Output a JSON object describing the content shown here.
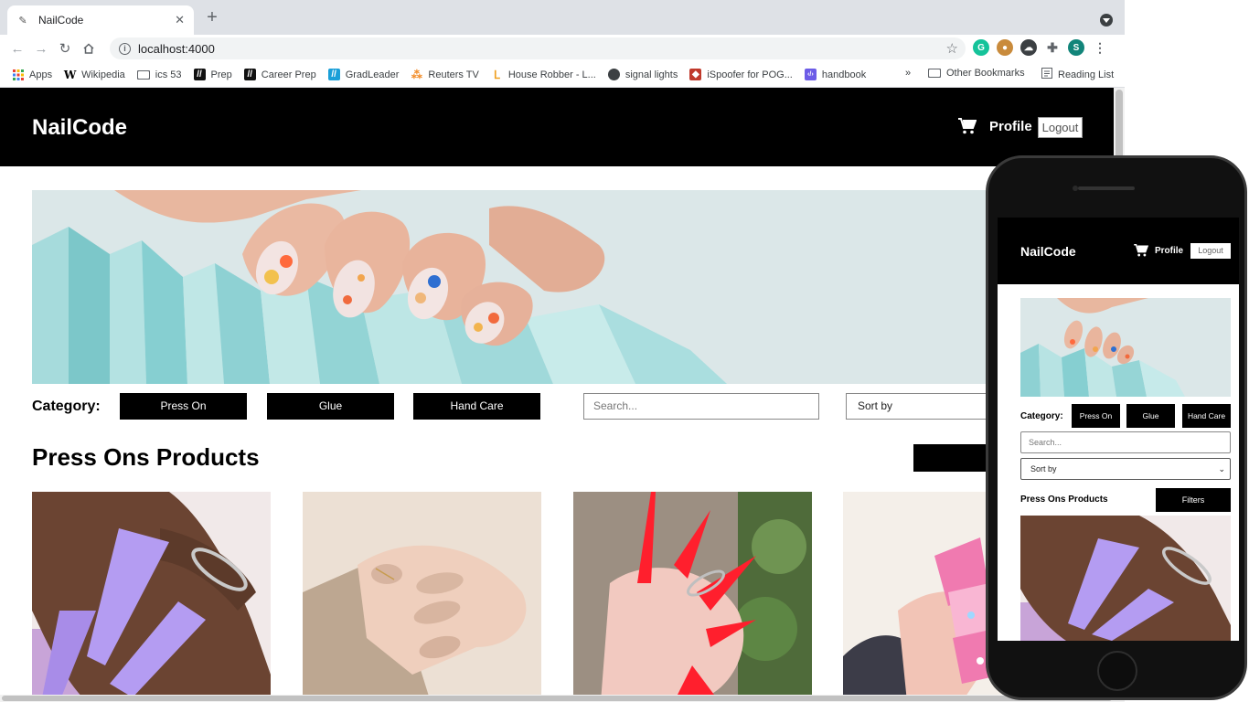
{
  "browser": {
    "tab_title": "NailCode",
    "url": "localhost:4000",
    "bookmarks": [
      {
        "label": "Apps",
        "icon": "apps-grid-icon",
        "color": "#ea4335"
      },
      {
        "label": "Wikipedia",
        "icon": "wikipedia-icon",
        "color": "#000000"
      },
      {
        "label": "ics 53",
        "icon": "folder-icon",
        "color": "#5f6368"
      },
      {
        "label": "Prep",
        "icon": "prep-icon",
        "color": "#111111"
      },
      {
        "label": "Career Prep",
        "icon": "career-prep-icon",
        "color": "#111111"
      },
      {
        "label": "GradLeader",
        "icon": "gradleader-icon",
        "color": "#1a9fd8"
      },
      {
        "label": "Reuters TV",
        "icon": "reuters-icon",
        "color": "#f28c28"
      },
      {
        "label": "House Robber - L...",
        "icon": "leetcode-icon",
        "color": "#f0a020"
      },
      {
        "label": "signal lights",
        "icon": "globe-icon",
        "color": "#3c4043"
      },
      {
        "label": "iSpoofer for POG...",
        "icon": "ispoofer-icon",
        "color": "#c0392b"
      },
      {
        "label": "handbook",
        "icon": "code-icon",
        "color": "#6c5ce7"
      }
    ],
    "overflow": "»",
    "other_bookmarks": "Other Bookmarks",
    "reading_list": "Reading List",
    "avatar_letter": "S"
  },
  "site": {
    "brand": "NailCode",
    "profile": "Profile",
    "logout": "Logout",
    "category_label": "Category:",
    "categories": [
      "Press On",
      "Glue",
      "Hand Care"
    ],
    "search_placeholder": "Search...",
    "sort_label": "Sort by",
    "products_title": "Press Ons Products",
    "filters_label": "Filters"
  },
  "mobile": {
    "brand": "NailCode",
    "profile": "Profile",
    "logout": "Logout",
    "category_label": "Category:",
    "categories": [
      "Press On",
      "Glue",
      "Hand Care"
    ],
    "search_placeholder": "Search...",
    "sort_label": "Sort by",
    "products_title": "Press Ons Products",
    "filters_label": "Filters"
  },
  "colors": {
    "header_bg": "#000000",
    "accent": "#000000",
    "lavender_nail": "#b49cf2",
    "red_nail": "#ff1f2d",
    "pink_nail": "#f07ab0",
    "nude_nail": "#d9b7a2",
    "teal_paper": "#9fd8d9"
  }
}
